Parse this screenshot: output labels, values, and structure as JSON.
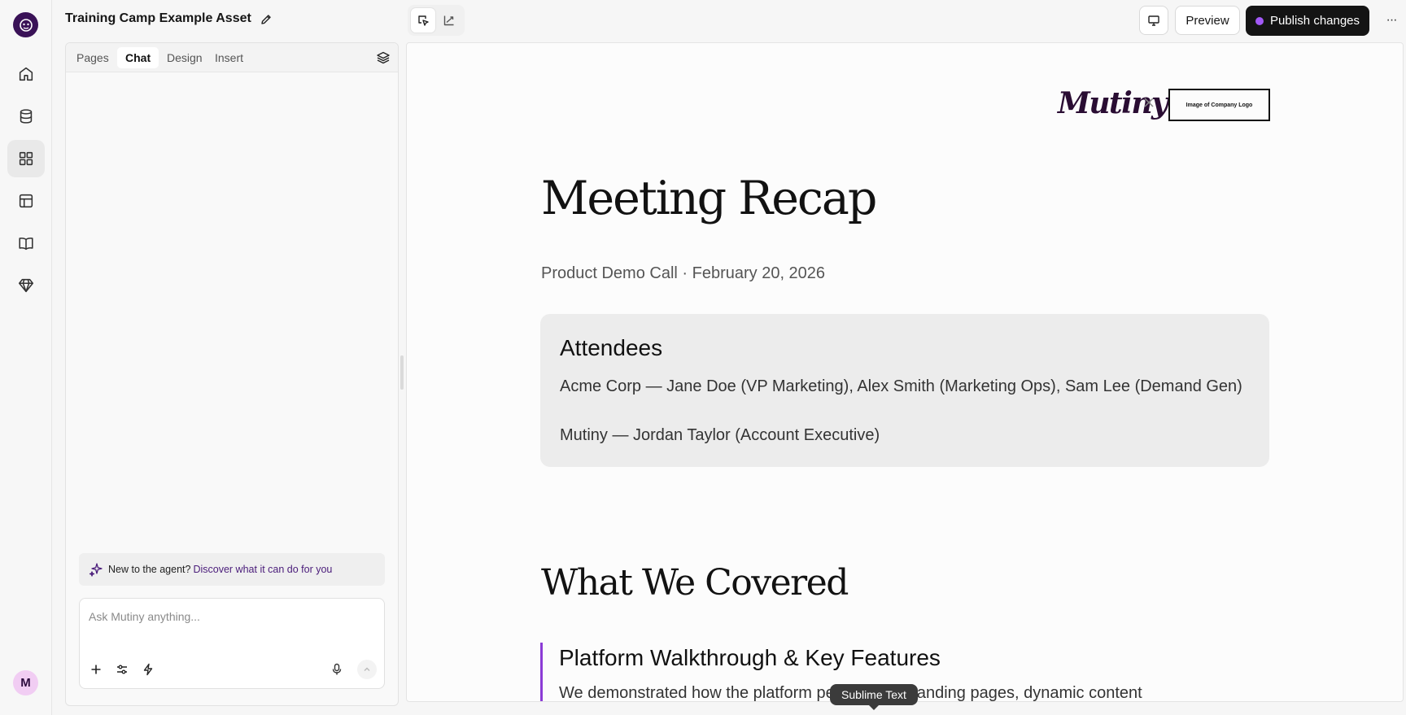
{
  "app": {
    "title": "Training Camp Example Asset",
    "accent_color": "#3a1257",
    "publish_dot_color": "#a259f7"
  },
  "rail": {
    "items": [
      {
        "icon": "home-icon"
      },
      {
        "icon": "database-icon"
      },
      {
        "icon": "grid-icon",
        "active": true
      },
      {
        "icon": "layout-icon"
      },
      {
        "icon": "book-icon"
      },
      {
        "icon": "diamond-icon"
      }
    ],
    "avatar_initial": "M"
  },
  "toolbar": {
    "preview_label": "Preview",
    "publish_label": "Publish changes",
    "more_label": "···"
  },
  "panel": {
    "tabs": [
      {
        "label": "Pages"
      },
      {
        "label": "Chat",
        "active": true
      },
      {
        "label": "Design"
      },
      {
        "label": "Insert"
      }
    ],
    "tip_text": "New to the agent?",
    "tip_link": "Discover what it can do for you",
    "chat_placeholder": "Ask Mutiny anything..."
  },
  "canvas": {
    "brand_logo": "Mutiny",
    "company_logo": "Image of Company Logo",
    "heading": "Meeting Recap",
    "subtitle": "Product Demo Call · February 20, 2026",
    "attendees": {
      "title": "Attendees",
      "lines": [
        "Acme Corp — Jane Doe (VP Marketing), Alex Smith (Marketing Ops), Sam Lee (Demand Gen)",
        "Mutiny — Jordan Taylor (Account Executive)"
      ]
    },
    "covered_heading": "What We Covered",
    "section": {
      "title": "Platform Walkthrough & Key Features",
      "body": "We demonstrated how the platform personalized landing pages, dynamic content"
    }
  },
  "tooltip": "Sublime Text"
}
